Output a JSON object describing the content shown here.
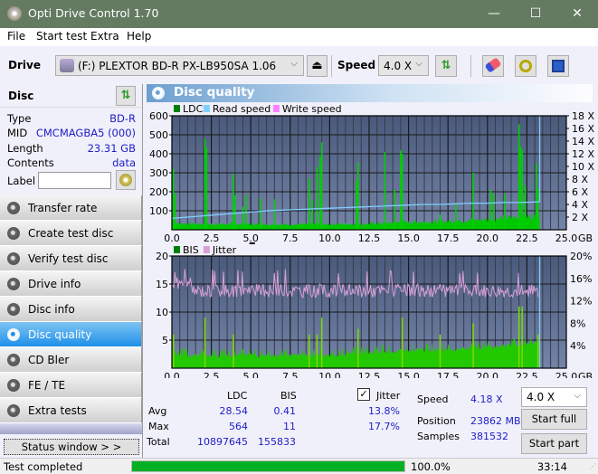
{
  "window": {
    "title": "Opti Drive Control 1.70",
    "minimize": "—",
    "maximize": "☐",
    "close": "✕"
  },
  "menu": {
    "file": "File",
    "start_test": "Start test",
    "extra": "Extra",
    "help": "Help"
  },
  "toolbar": {
    "drive_label": "Drive",
    "drive_value": "(F:)  PLEXTOR BD-R  PX-LB950SA 1.06",
    "speed_label": "Speed",
    "speed_value": "4.0 X",
    "eject_icon": "⏏",
    "refresh_icon": "⇅",
    "erase_icon": "eraser",
    "settings_icon": "gears",
    "save_icon": "floppy"
  },
  "disc": {
    "header": "Disc",
    "type_label": "Type",
    "type_value": "BD-R",
    "mid_label": "MID",
    "mid_value": "CMCMAGBA5 (000)",
    "length_label": "Length",
    "length_value": "23.31 GB",
    "contents_label": "Contents",
    "contents_value": "data",
    "label_label": "Label",
    "label_value": ""
  },
  "nav": [
    {
      "label": "Transfer rate",
      "active": false
    },
    {
      "label": "Create test disc",
      "active": false
    },
    {
      "label": "Verify test disc",
      "active": false
    },
    {
      "label": "Drive info",
      "active": false
    },
    {
      "label": "Disc info",
      "active": false
    },
    {
      "label": "Disc quality",
      "active": true
    },
    {
      "label": "CD Bler",
      "active": false
    },
    {
      "label": "FE / TE",
      "active": false
    },
    {
      "label": "Extra tests",
      "active": false
    }
  ],
  "status_window_button": "Status window > >",
  "panel": {
    "title": "Disc quality"
  },
  "stats": {
    "col_ldc": "LDC",
    "col_bis": "BIS",
    "jitter_label": "Jitter",
    "jitter_checked": true,
    "avg_label": "Avg",
    "max_label": "Max",
    "total_label": "Total",
    "ldc_avg": "28.54",
    "ldc_max": "564",
    "ldc_total": "10897645",
    "bis_avg": "0.41",
    "bis_max": "11",
    "bis_total": "155833",
    "jitter_avg": "13.8%",
    "jitter_max": "17.7%",
    "speed_label": "Speed",
    "speed_value": "4.18 X",
    "position_label": "Position",
    "position_value": "23862 MB",
    "samples_label": "Samples",
    "samples_value": "381532",
    "speed_select": "4.0 X",
    "start_full": "Start full",
    "start_part": "Start part"
  },
  "statusbar": {
    "text": "Test completed",
    "progress": 100.0,
    "progress_text": "100.0%",
    "elapsed": "33:14"
  },
  "chart_data": [
    {
      "type": "bar",
      "title": "LDC / Read speed",
      "legend": [
        "LDC",
        "Read speed",
        "Write speed"
      ],
      "legend_colors": [
        "#008000",
        "#7fcfff",
        "#ff80ff"
      ],
      "xlabel": "GB",
      "x_ticks": [
        "0.0",
        "2.5",
        "5.0",
        "7.5",
        "10.0",
        "12.5",
        "15.0",
        "17.5",
        "20.0",
        "22.5",
        "25.0"
      ],
      "xlim": [
        0,
        25
      ],
      "y_ticks": [
        "100",
        "200",
        "300",
        "400",
        "500",
        "600"
      ],
      "ylim": [
        0,
        600
      ],
      "y2_ticks": [
        "2 X",
        "4 X",
        "6 X",
        "8 X",
        "10 X",
        "12 X",
        "14 X",
        "16 X",
        "18 X"
      ],
      "y2lim": [
        0,
        18
      ],
      "disc_end_gb": 23.31,
      "ldc_baseline": [
        [
          0,
          35
        ],
        [
          2.5,
          30
        ],
        [
          5,
          30
        ],
        [
          7.5,
          28
        ],
        [
          10,
          30
        ],
        [
          12.5,
          32
        ],
        [
          15,
          40
        ],
        [
          17.5,
          45
        ],
        [
          20,
          55
        ],
        [
          22.5,
          70
        ],
        [
          23.3,
          75
        ]
      ],
      "ldc_spikes": [
        [
          0.1,
          320
        ],
        [
          0.2,
          190
        ],
        [
          2.1,
          480
        ],
        [
          2.2,
          430
        ],
        [
          3.9,
          295
        ],
        [
          4.0,
          180
        ],
        [
          4.5,
          120
        ],
        [
          4.7,
          185
        ],
        [
          5.6,
          165
        ],
        [
          6.5,
          160
        ],
        [
          8.7,
          270
        ],
        [
          8.9,
          155
        ],
        [
          9.2,
          330
        ],
        [
          9.4,
          385
        ],
        [
          9.5,
          460
        ],
        [
          11.7,
          260
        ],
        [
          11.8,
          355
        ],
        [
          13.5,
          410
        ],
        [
          14.1,
          210
        ],
        [
          14.5,
          420
        ],
        [
          14.6,
          400
        ],
        [
          17.0,
          80
        ],
        [
          18.0,
          140
        ],
        [
          19.1,
          300
        ],
        [
          20.2,
          210
        ],
        [
          20.4,
          190
        ],
        [
          21.1,
          190
        ],
        [
          22.0,
          555
        ],
        [
          22.1,
          440
        ],
        [
          22.2,
          420
        ],
        [
          22.4,
          235
        ],
        [
          23.1,
          350
        ],
        [
          23.2,
          215
        ]
      ],
      "read_speed": [
        [
          0,
          1.8
        ],
        [
          1,
          2.0
        ],
        [
          2,
          2.2
        ],
        [
          3,
          2.4
        ],
        [
          4,
          2.6
        ],
        [
          5,
          2.8
        ],
        [
          6,
          3.0
        ],
        [
          7,
          3.1
        ],
        [
          8,
          3.2
        ],
        [
          9,
          3.3
        ],
        [
          10,
          3.4
        ],
        [
          11,
          3.5
        ],
        [
          12,
          3.6
        ],
        [
          13,
          3.7
        ],
        [
          14,
          3.8
        ],
        [
          15,
          3.9
        ],
        [
          16,
          4.0
        ],
        [
          17,
          4.0
        ],
        [
          18,
          4.1
        ],
        [
          19,
          4.2
        ],
        [
          20,
          4.2
        ],
        [
          21,
          4.3
        ],
        [
          22,
          4.3
        ],
        [
          23.3,
          4.4
        ]
      ]
    },
    {
      "type": "bar",
      "title": "BIS / Jitter",
      "legend": [
        "BIS",
        "Jitter"
      ],
      "legend_colors": [
        "#008000",
        "#d8a0d8"
      ],
      "xlabel": "GB",
      "x_ticks": [
        "0.0",
        "2.5",
        "5.0",
        "7.5",
        "10.0",
        "12.5",
        "15.0",
        "17.5",
        "20.0",
        "22.5",
        "25.0"
      ],
      "xlim": [
        0,
        25
      ],
      "y_ticks": [
        "5",
        "10",
        "15",
        "20"
      ],
      "ylim": [
        0,
        20
      ],
      "y2_ticks": [
        "4%",
        "8%",
        "12%",
        "16%",
        "20%"
      ],
      "y2lim": [
        0,
        20
      ],
      "disc_end_gb": 23.31,
      "bis_baseline": [
        [
          0,
          2.5
        ],
        [
          5,
          2.5
        ],
        [
          10,
          2.5
        ],
        [
          12.5,
          3
        ],
        [
          15,
          3.5
        ],
        [
          17.5,
          3.5
        ],
        [
          20,
          4
        ],
        [
          22.5,
          4.5
        ],
        [
          23.3,
          5
        ]
      ],
      "bis_spikes": [
        [
          0.1,
          6
        ],
        [
          2.1,
          9
        ],
        [
          3.9,
          6
        ],
        [
          8.7,
          6
        ],
        [
          9.2,
          6
        ],
        [
          9.5,
          9
        ],
        [
          11.8,
          7
        ],
        [
          14.6,
          9
        ],
        [
          17.0,
          6
        ],
        [
          19.1,
          8
        ],
        [
          22.0,
          11
        ],
        [
          22.2,
          11
        ],
        [
          23.2,
          6
        ]
      ],
      "jitter_avg_pct": 13.8,
      "jitter_max_pct": 17.7,
      "jitter_range_pct": [
        11,
        17.7
      ]
    }
  ]
}
